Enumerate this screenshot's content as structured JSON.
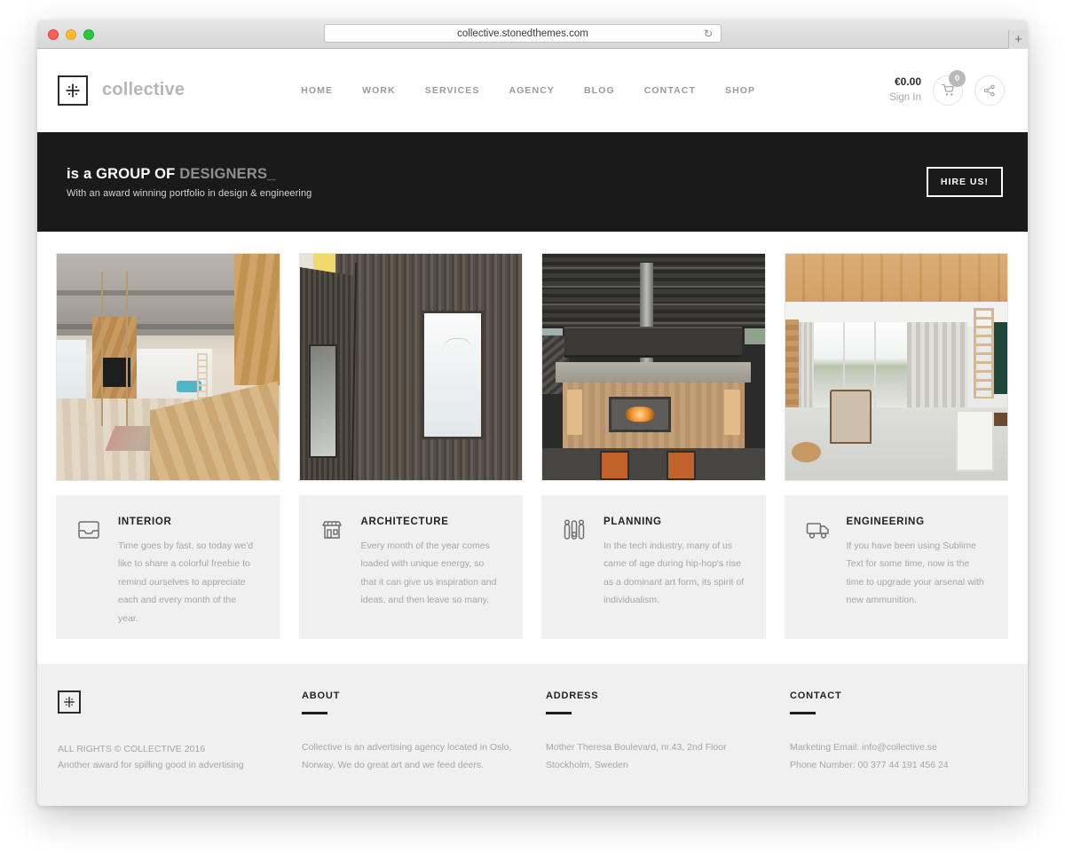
{
  "browser": {
    "url": "collective.stonedthemes.com",
    "reload_icon": "reload-icon",
    "new_tab_label": "+"
  },
  "header": {
    "logo_icon": "collective-logo-icon",
    "brand": "collective",
    "nav": [
      {
        "label": "HOME"
      },
      {
        "label": "WORK"
      },
      {
        "label": "SERVICES"
      },
      {
        "label": "AGENCY"
      },
      {
        "label": "BLOG"
      },
      {
        "label": "CONTACT"
      },
      {
        "label": "SHOP"
      }
    ],
    "cart_total": "€0.00",
    "sign_in": "Sign In",
    "cart_count": "0",
    "cart_icon": "shopping-cart-icon",
    "share_icon": "share-icon"
  },
  "hero": {
    "title_strong": "is a GROUP OF ",
    "title_muted": "DESIGNERS_",
    "subtitle": "With an award winning portfolio in design & engineering",
    "cta_label": "HIRE US!",
    "background": "#1a1a1a"
  },
  "portfolio": [
    {
      "alt": "wooden-loft-interior-photo"
    },
    {
      "alt": "dark-slat-facade-photo"
    },
    {
      "alt": "industrial-loft-fireplace-photo"
    },
    {
      "alt": "bright-room-lake-view-photo"
    }
  ],
  "services": [
    {
      "icon": "inbox-tray-icon",
      "title": "INTERIOR",
      "text": "Time goes by fast, so today we'd like to share a colorful freebie to remind ourselves to appreciate each and every month of the year."
    },
    {
      "icon": "storefront-icon",
      "title": "ARCHITECTURE",
      "text": "Every month of the year comes loaded with unique energy, so that it can give us inspiration and ideas, and then leave so many."
    },
    {
      "icon": "sliders-icon",
      "title": "PLANNING",
      "text": "In the tech industry, many of us came of age during hip-hop's rise as a dominant art form, its spirit of individualism."
    },
    {
      "icon": "delivery-truck-icon",
      "title": "ENGINEERING",
      "text": "If you have been using Sublime Text for some time, now is the time to upgrade your arsenal with new ammunition."
    }
  ],
  "footer": {
    "logo_icon": "collective-logo-icon",
    "copyright": "ALL RIGHTS © COLLECTIVE 2016",
    "tagline": "Another award for spilling good in advertising",
    "columns": [
      {
        "title": "ABOUT",
        "line1": "Collective is an advertising agency located in Oslo,",
        "line2": "Norway. We do great art and we feed deers."
      },
      {
        "title": "ADDRESS",
        "line1": "Mother Theresa Boulevard, nr.43, 2nd Floor",
        "line2": "Stockholm, Sweden"
      },
      {
        "title": "CONTACT",
        "line1": "Marketing Email: info@collective.se",
        "line2": "Phone Number: 00 377 44 191 456 24"
      }
    ]
  }
}
